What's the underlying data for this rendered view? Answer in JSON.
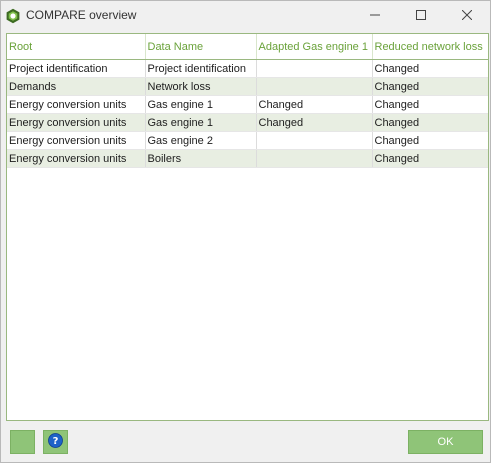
{
  "window": {
    "title": "COMPARE overview",
    "icons": {
      "app": "hexagon-ring-icon",
      "minimize": "minimize-icon",
      "maximize": "maximize-icon",
      "close": "close-icon"
    }
  },
  "colors": {
    "accent": "#6aa23a",
    "button": "#8fc478",
    "row_alt": "#e8eee2",
    "help": "#1e63c8"
  },
  "table": {
    "columns": [
      "Root",
      "Data Name",
      "Adapted Gas engine 1",
      "Reduced network loss"
    ],
    "rows": [
      [
        "Project identification",
        "Project identification",
        "",
        "Changed"
      ],
      [
        "Demands",
        "Network loss",
        "",
        "Changed"
      ],
      [
        "Energy conversion units",
        "Gas engine 1",
        "Changed",
        "Changed"
      ],
      [
        "Energy conversion units",
        "Gas engine 1",
        "Changed",
        "Changed"
      ],
      [
        "Energy conversion units",
        "Gas engine 2",
        "",
        "Changed"
      ],
      [
        "Energy conversion units",
        "Boilers",
        "",
        "Changed"
      ]
    ]
  },
  "footer": {
    "ok_label": "OK",
    "help_icon": "question-mark-icon"
  }
}
